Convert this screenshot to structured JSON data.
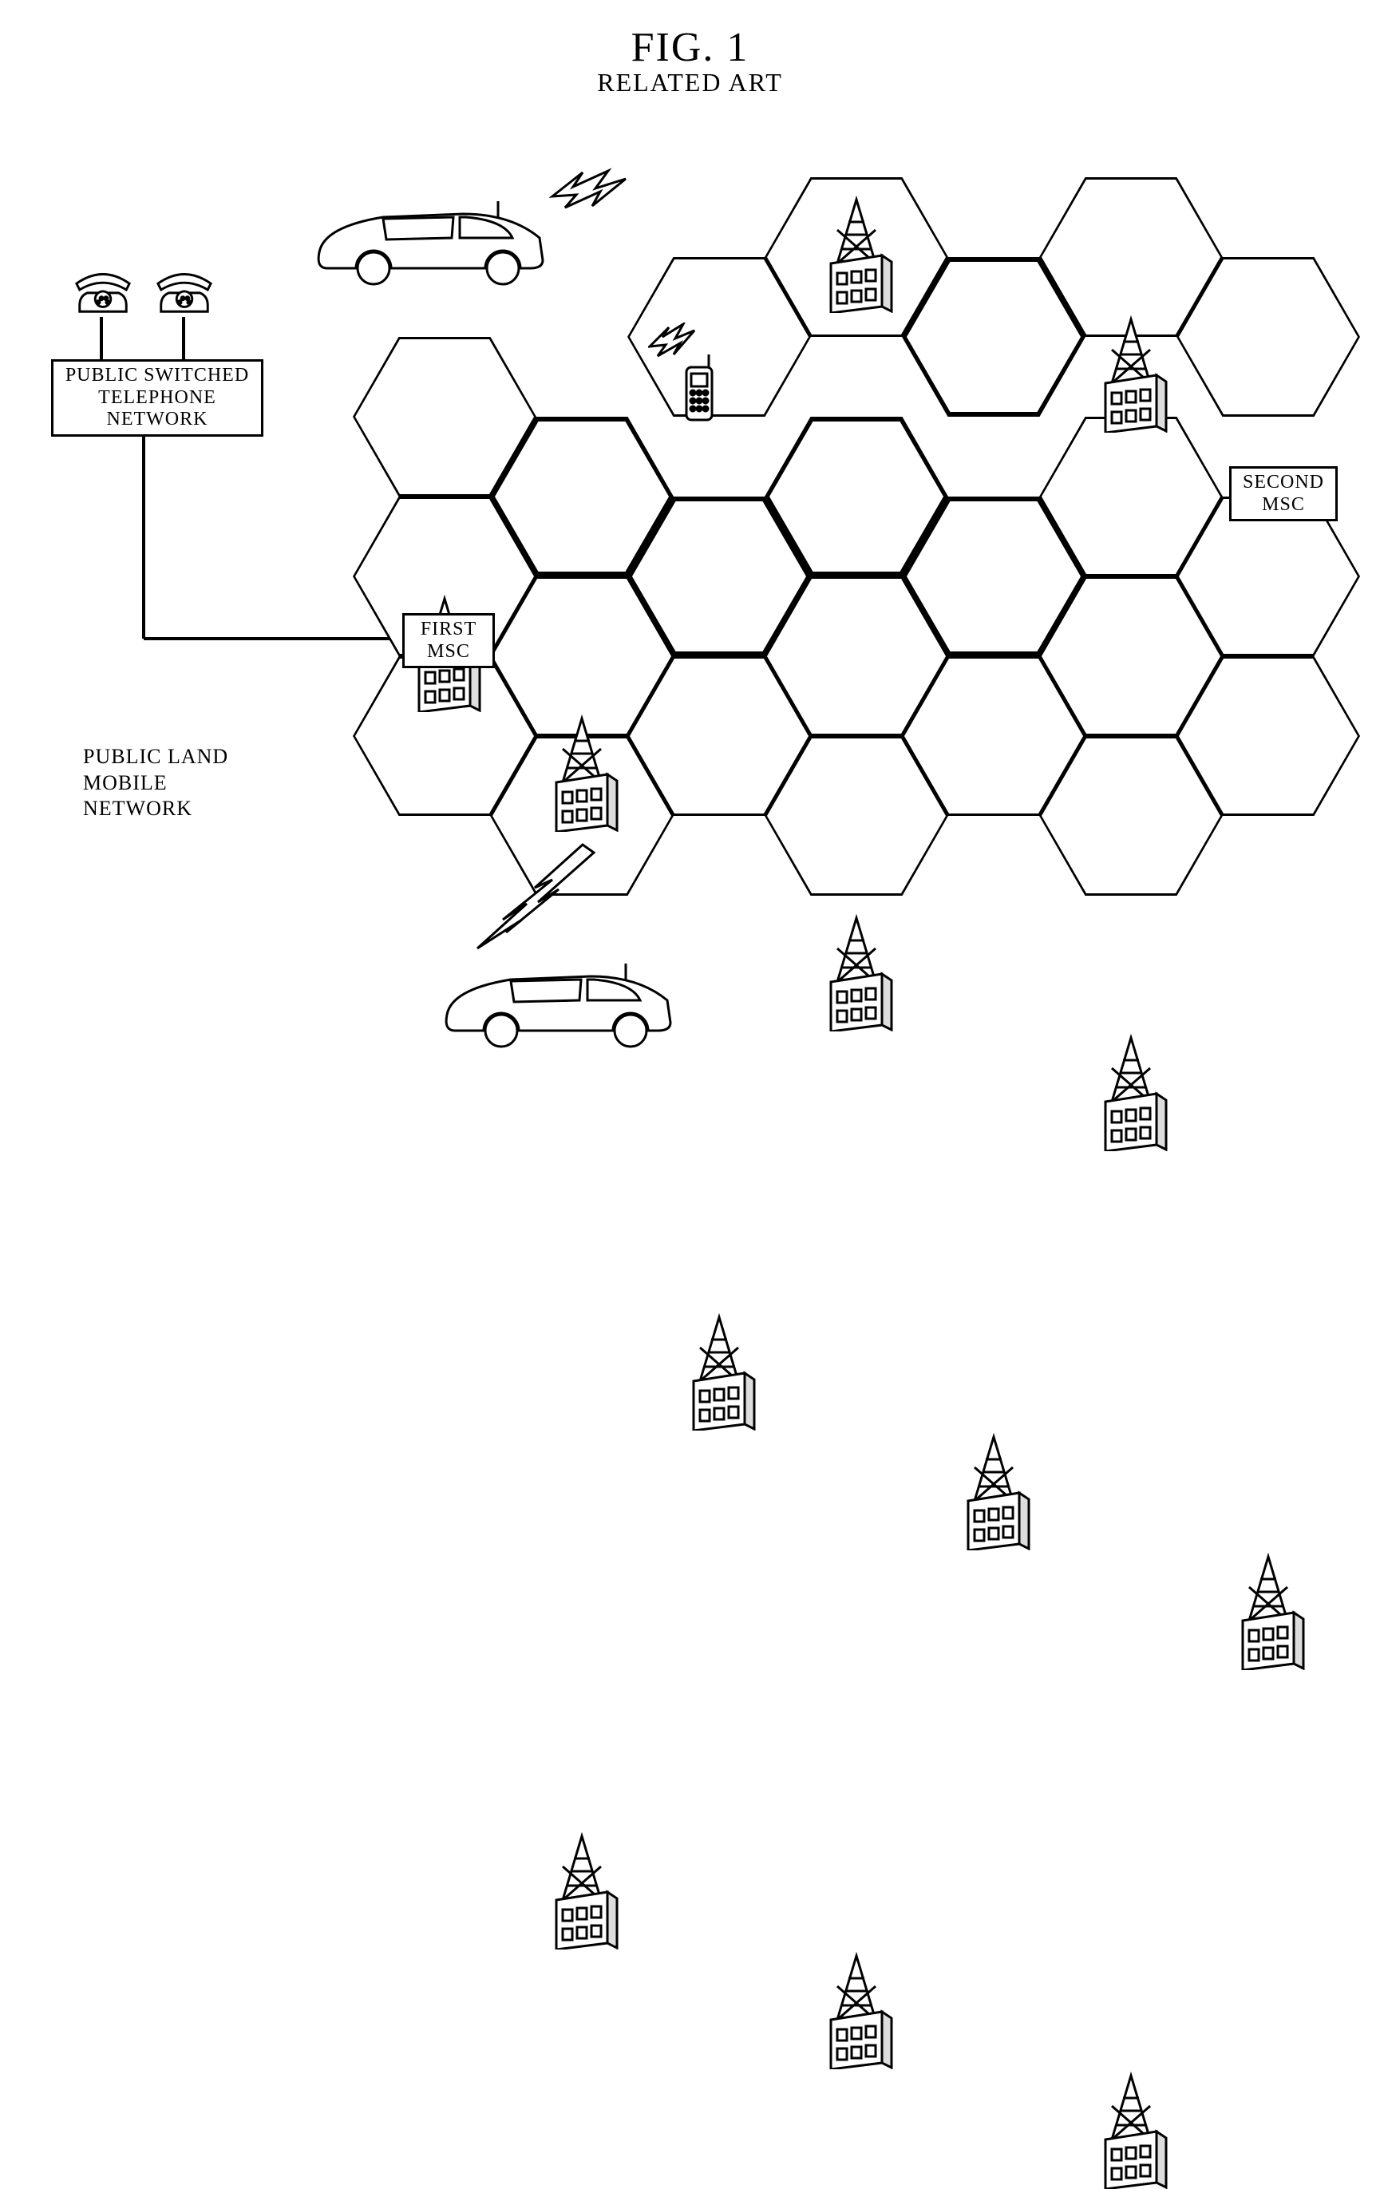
{
  "figure": {
    "title": "FIG.  1",
    "subtitle": "RELATED ART"
  },
  "labels": {
    "pstn": "PUBLIC SWITCHED\nTELEPHONE NETWORK",
    "first_msc": "FIRST\nMSC",
    "second_msc": "SECOND\nMSC",
    "plmn": "PUBLIC LAND MOBILE\nNETWORK"
  },
  "icons": {
    "phone": "telephone-icon",
    "car": "car-icon",
    "tower": "cell-tower-icon",
    "handset": "mobile-handset-icon",
    "bolt": "radio-signal-icon"
  }
}
